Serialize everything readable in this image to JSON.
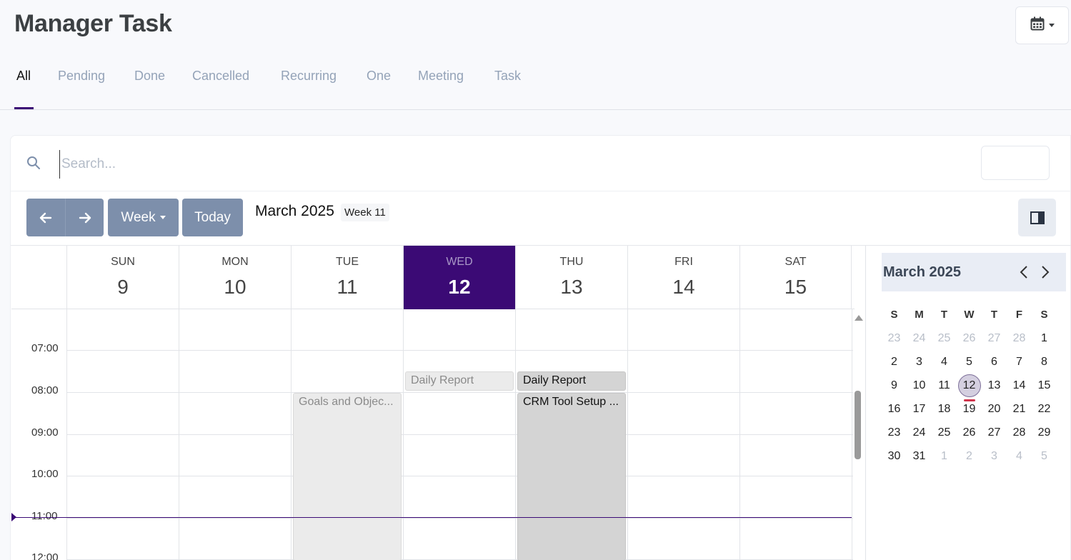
{
  "header": {
    "title": "Manager Task"
  },
  "tabs": [
    {
      "label": "All",
      "active": true
    },
    {
      "label": "Pending"
    },
    {
      "label": "Done"
    },
    {
      "label": "Cancelled"
    },
    {
      "label": "Recurring"
    },
    {
      "label": "One"
    },
    {
      "label": "Meeting"
    },
    {
      "label": "Task"
    }
  ],
  "search": {
    "placeholder": "Search...",
    "value": ""
  },
  "toolbar": {
    "view_label": "Week",
    "today_label": "Today",
    "range_title": "March 2025",
    "week_badge": "Week 11"
  },
  "week": {
    "days": [
      {
        "name": "SUN",
        "date": "9"
      },
      {
        "name": "MON",
        "date": "10"
      },
      {
        "name": "TUE",
        "date": "11"
      },
      {
        "name": "WED",
        "date": "12",
        "today": true
      },
      {
        "name": "THU",
        "date": "13"
      },
      {
        "name": "FRI",
        "date": "14"
      },
      {
        "name": "SAT",
        "date": "15"
      }
    ],
    "time_labels": [
      "07:00",
      "08:00",
      "09:00",
      "10:00",
      "11:00",
      "12:00"
    ]
  },
  "events": [
    {
      "title": "Daily Report",
      "day": "WED"
    },
    {
      "title": "Daily Report",
      "day": "THU"
    },
    {
      "title": "Goals and Objec...",
      "day": "TUE"
    },
    {
      "title": "CRM Tool Setup ...",
      "day": "THU"
    }
  ],
  "mini_calendar": {
    "title": "March 2025",
    "dow": [
      "S",
      "M",
      "T",
      "W",
      "T",
      "F",
      "S"
    ],
    "weeks": [
      [
        "23",
        "24",
        "25",
        "26",
        "27",
        "28",
        "1"
      ],
      [
        "2",
        "3",
        "4",
        "5",
        "6",
        "7",
        "8"
      ],
      [
        "9",
        "10",
        "11",
        "12",
        "13",
        "14",
        "15"
      ],
      [
        "16",
        "17",
        "18",
        "19",
        "20",
        "21",
        "22"
      ],
      [
        "23",
        "24",
        "25",
        "26",
        "27",
        "28",
        "29"
      ],
      [
        "30",
        "31",
        "1",
        "2",
        "3",
        "4",
        "5"
      ]
    ],
    "selected": "12"
  },
  "icons": {
    "calendar": "calendar-icon",
    "search": "search-icon",
    "sidebar": "sidebar-toggle-icon"
  },
  "colors": {
    "accent": "#3b0a75",
    "button": "#7d8fab"
  }
}
